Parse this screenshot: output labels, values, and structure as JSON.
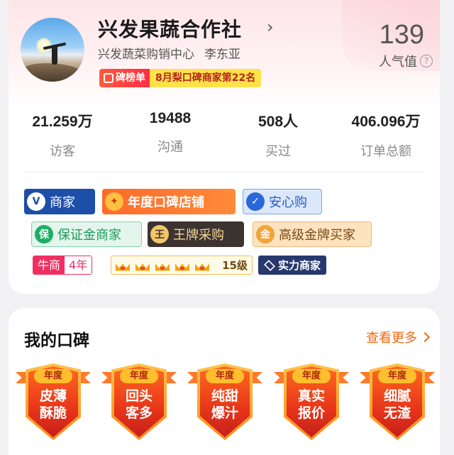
{
  "shop": {
    "name": "兴发果蔬合作社",
    "arrow": "›",
    "sub_org": "兴发蔬菜购销中心",
    "sub_person": "李东亚",
    "rank_label": "碑榜单",
    "rank_text": "8月梨口碑商家第22名",
    "popularity_value": "139",
    "popularity_label": "人气值",
    "help_icon": "?"
  },
  "stats": [
    {
      "value": "21.259万",
      "label": "访客"
    },
    {
      "value": "19488",
      "label": "沟通"
    },
    {
      "value": "508人",
      "label": "买过"
    },
    {
      "value": "406.096万",
      "label": "订单总额"
    }
  ],
  "tags": {
    "merchant": {
      "icon": "V",
      "label": "商家"
    },
    "year": {
      "icon": "✦",
      "label": "年度口碑店铺"
    },
    "safe": {
      "icon": "✓",
      "label": "安心购"
    },
    "deposit": {
      "icon": "保",
      "label": "保证金商家"
    },
    "king": {
      "icon": "王",
      "label": "王牌采购"
    },
    "gold": {
      "icon": "金",
      "label": "高级金牌买家"
    },
    "niu_a": "牛商",
    "niu_b": "4年",
    "crown_level": "15级",
    "strength": "实力商家"
  },
  "reputation": {
    "title": "我的口碑",
    "more": "查看更多",
    "year_label": "年度",
    "badges": [
      {
        "line1": "皮薄",
        "line2": "酥脆"
      },
      {
        "line1": "回头",
        "line2": "客多"
      },
      {
        "line1": "纯甜",
        "line2": "爆汁"
      },
      {
        "line1": "真实",
        "line2": "报价"
      },
      {
        "line1": "细腻",
        "line2": "无渣"
      }
    ]
  },
  "colors": {
    "accent_orange": "#ef6a14",
    "merchant_blue": "#1d4ea8",
    "niu_pink": "#ef2f62"
  }
}
